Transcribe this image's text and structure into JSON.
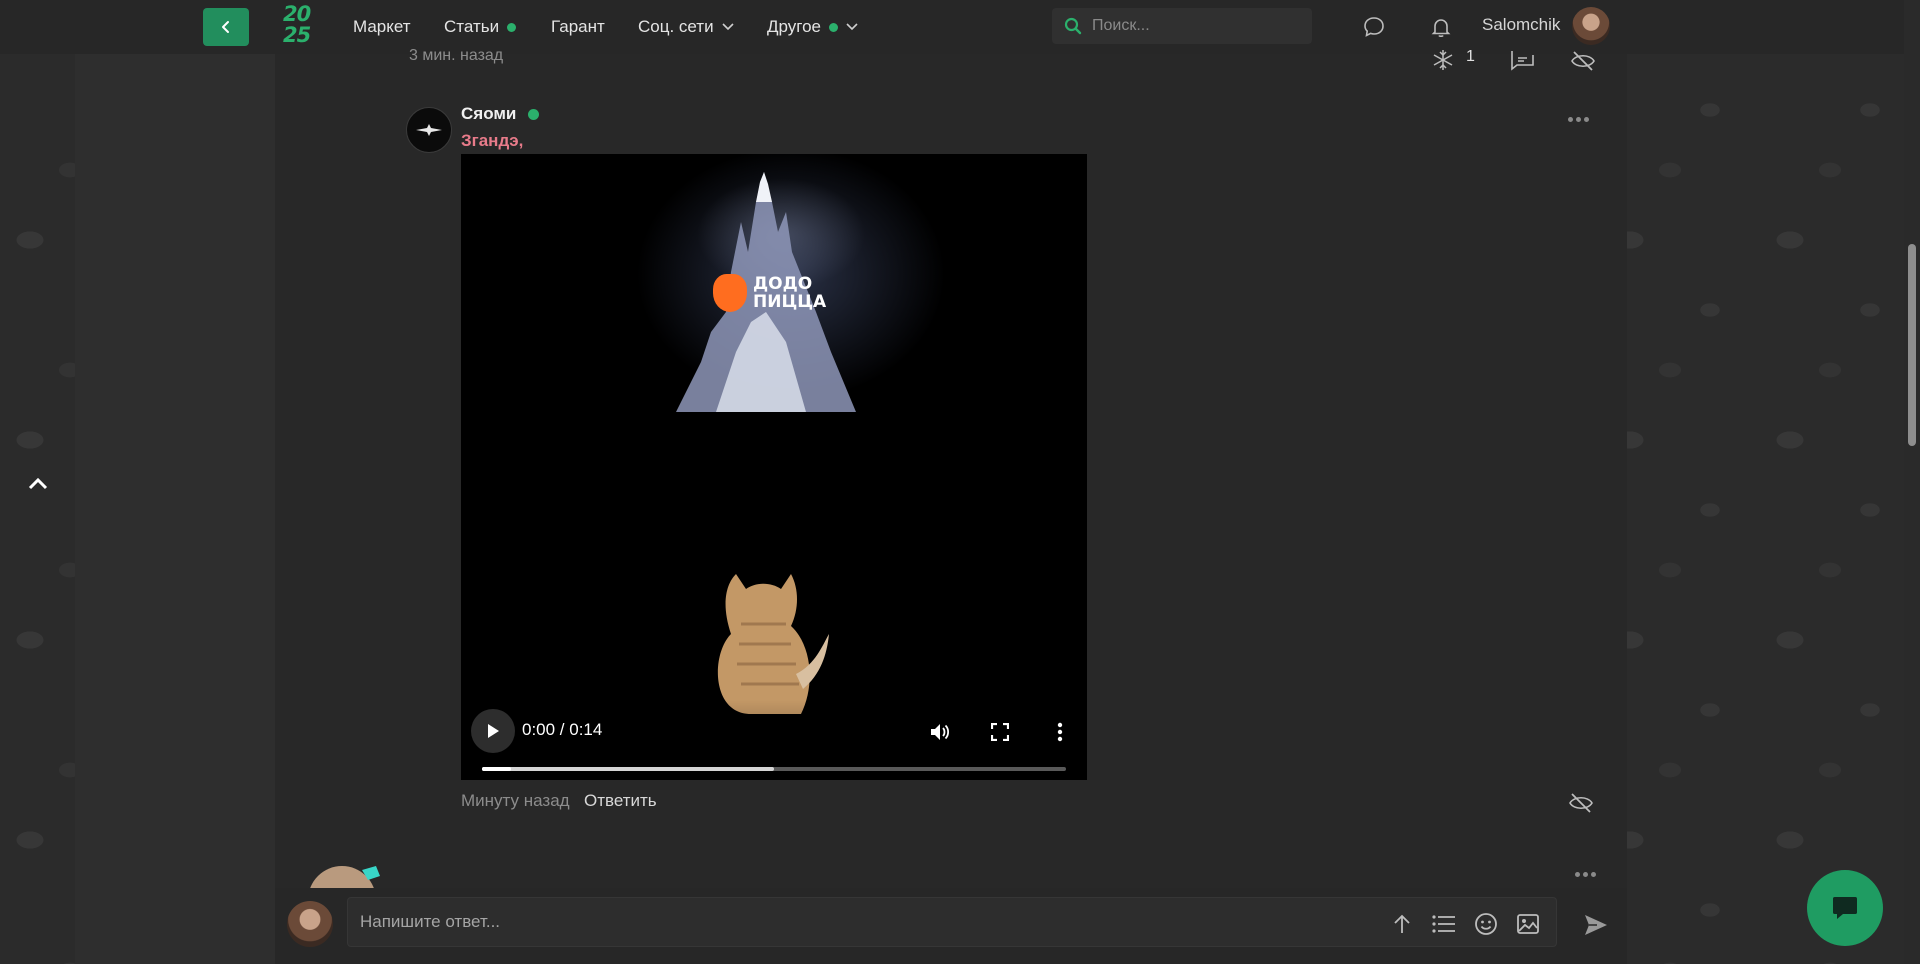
{
  "nav": {
    "logo_top": "20",
    "logo_bottom": "25",
    "items": [
      {
        "label": "Маркет"
      },
      {
        "label": "Статьи"
      },
      {
        "label": "Гарант"
      },
      {
        "label": "Соц. сети"
      },
      {
        "label": "Другое"
      }
    ],
    "search_placeholder": "Поиск...",
    "username": "Salomchik"
  },
  "thread": {
    "top_time": "3 мин. назад",
    "top_reaction_count": "1"
  },
  "post": {
    "author": "Сяоми",
    "mention": "Згандэ,",
    "video": {
      "brand_line1": "ДОДО",
      "brand_line2": "ПИЦЦА",
      "time": "0:00 / 0:14",
      "played_fraction": 0.05,
      "buffered_fraction": 0.5
    },
    "time": "Минуту назад",
    "reply_label": "Ответить"
  },
  "reply_box": {
    "placeholder": "Напишите ответ..."
  },
  "colors": {
    "accent": "#2bb06c",
    "mention": "#e87b8a",
    "background": "#2b2b2b"
  }
}
